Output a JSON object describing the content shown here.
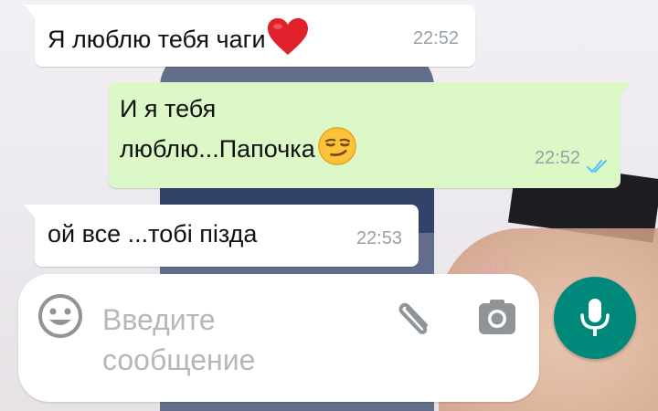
{
  "messages": [
    {
      "direction": "incoming",
      "text": "Я люблю тебя чаги",
      "emoji": "red-heart",
      "time": "22:52"
    },
    {
      "direction": "outgoing",
      "line1": "И я тебя",
      "line2": "люблю...Папочка",
      "emoji": "smirking-face",
      "time": "22:52",
      "status": "read"
    },
    {
      "direction": "incoming",
      "text": "ой все ...тобі пізда",
      "time": "22:53"
    }
  ],
  "composer": {
    "placeholder_line1": "Введите",
    "placeholder_line2": "сообщение",
    "icons": [
      "smiley-icon",
      "paperclip-icon",
      "camera-icon",
      "mic-icon"
    ]
  },
  "colors": {
    "incoming_bubble": "#ffffff",
    "outgoing_bubble": "#dcf8c6",
    "timestamp": "#98a0a6",
    "read_ticks": "#4fc3f7",
    "mic_button": "#00897b",
    "placeholder": "#b4b8ba",
    "icon_gray": "#8e9497"
  }
}
